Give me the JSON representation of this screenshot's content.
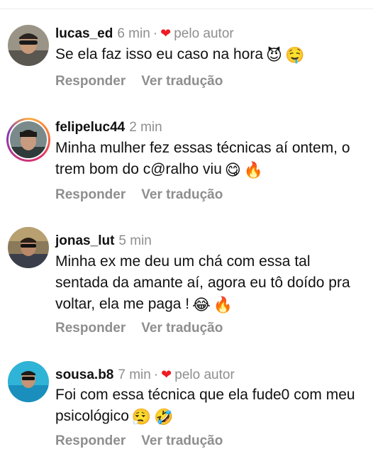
{
  "comments": [
    {
      "username": "lucas_ed",
      "time": "6 min",
      "separator": "·",
      "liked_by_author_label": "pelo autor",
      "text": "Se ela faz isso eu caso na hora",
      "emojis": [
        "😈",
        "🤤"
      ],
      "reply_label": "Responder",
      "translate_label": "Ver tradução"
    },
    {
      "username": "felipeluc44",
      "time": "2 min",
      "text": "Minha mulher fez essas técnicas aí ontem, o trem bom do c@ralho viu",
      "emojis": [
        "😋",
        "🔥"
      ],
      "reply_label": "Responder",
      "translate_label": "Ver tradução"
    },
    {
      "username": "jonas_lut",
      "time": "5 min",
      "text": "Minha ex me deu um chá com essa tal sentada da amante aí, agora eu tô doído pra voltar, ela me paga !",
      "emojis": [
        "😂",
        "🔥"
      ],
      "reply_label": "Responder",
      "translate_label": "Ver tradução"
    },
    {
      "username": "sousa.b8",
      "time": "7 min",
      "separator": "·",
      "liked_by_author_label": "pelo autor",
      "text": "Foi com essa técnica que ela fude0 com meu psicológico",
      "emojis": [
        "😮‍💨",
        "🤣"
      ],
      "reply_label": "Responder",
      "translate_label": "Ver tradução"
    }
  ]
}
